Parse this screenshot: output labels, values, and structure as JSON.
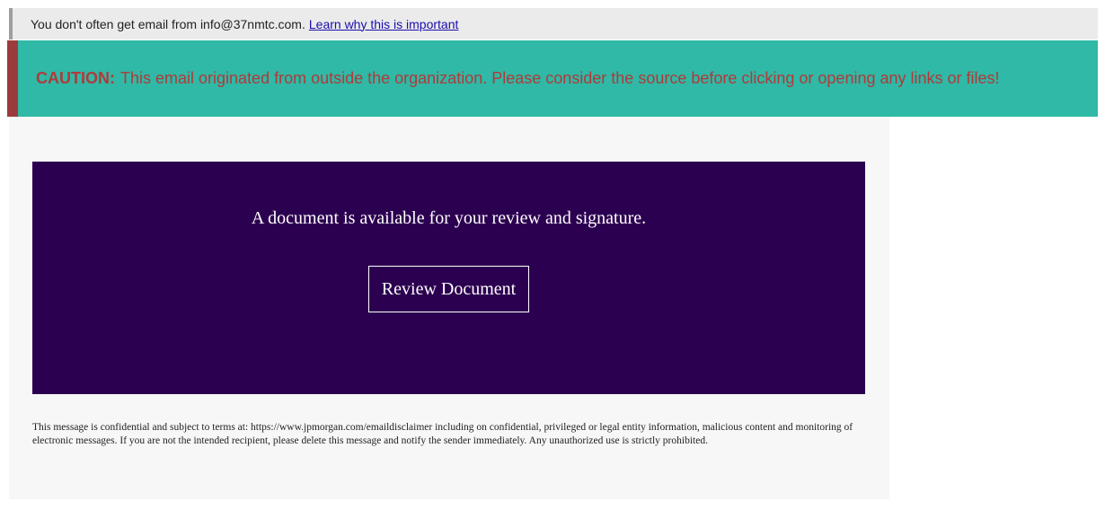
{
  "notice": {
    "text": "You don't often get email from info@37nmtc.com.",
    "link_label": "Learn why this is important"
  },
  "caution": {
    "label": "CAUTION:",
    "message": "This email originated from outside the organization. Please consider the source before clicking or opening any links or files!"
  },
  "hero": {
    "message": "A document is available for your review and signature.",
    "button_label": "Review Document"
  },
  "disclaimer": {
    "text": "This message is confidential and subject to terms at: https://www.jpmorgan.com/emaildisclaimer including on confidential, privileged or legal entity information, malicious content and monitoring of electronic messages. If you are not the intended recipient, please delete this message and notify the sender immediately. Any unauthorized use is strictly prohibited."
  },
  "colors": {
    "caution_background": "#2fb9a6",
    "caution_text": "#b03a3a",
    "hero_background": "#2c0050",
    "link": "#1a0dab"
  }
}
